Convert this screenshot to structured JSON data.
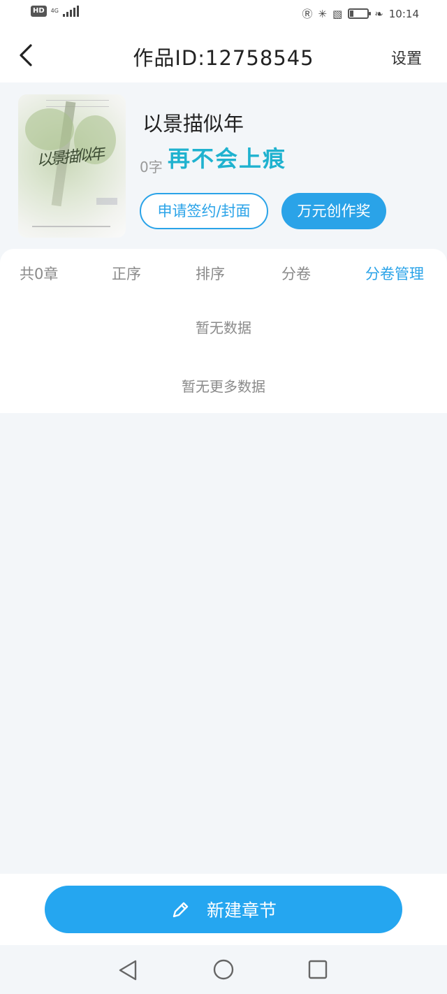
{
  "status_bar": {
    "hd": "HD",
    "network": "4G",
    "time": "10:14",
    "battery": "31"
  },
  "header": {
    "title": "作品ID:12758545",
    "settings_label": "设置"
  },
  "book": {
    "name": "以景描似年",
    "word_count": "0字",
    "watermark": "再不会上痕",
    "cover_text": "以景描似年"
  },
  "actions": {
    "apply_label": "申请签约/封面",
    "award_label": "万元创作奖"
  },
  "tabs": [
    {
      "label": "共0章",
      "active": false
    },
    {
      "label": "正序",
      "active": false
    },
    {
      "label": "排序",
      "active": false
    },
    {
      "label": "分卷",
      "active": false
    },
    {
      "label": "分卷管理",
      "active": true
    }
  ],
  "empty": {
    "no_data": "暂无数据",
    "no_more": "暂无更多数据"
  },
  "footer": {
    "new_chapter_label": "新建章节"
  },
  "colors": {
    "accent": "#2aa3e8",
    "primary_button": "#25a6f0",
    "background": "#f3f6f9"
  }
}
